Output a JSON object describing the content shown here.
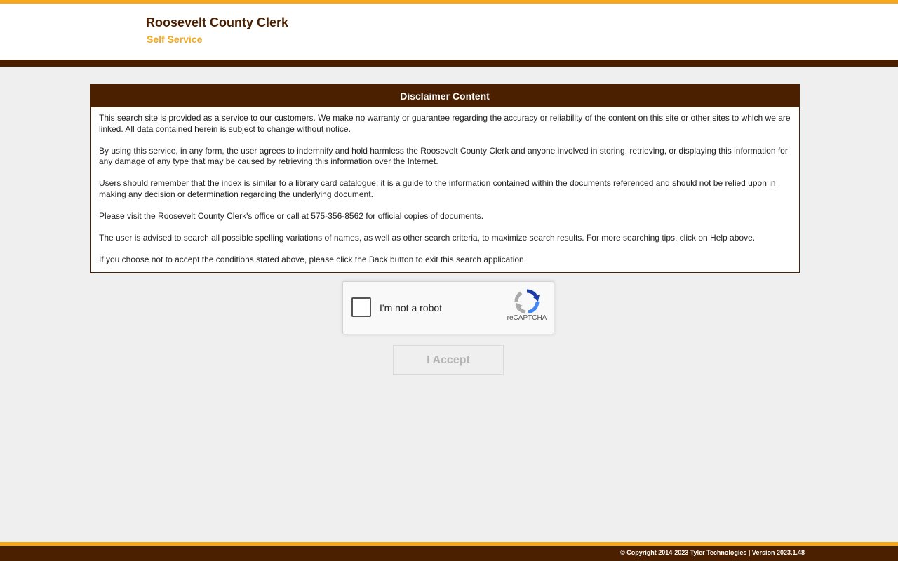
{
  "header": {
    "title": "Roosevelt County Clerk",
    "subtitle": "Self Service"
  },
  "disclaimer": {
    "heading": "Disclaimer Content",
    "paragraphs": [
      "This search site is provided as a service to our customers. We make no warranty or guarantee regarding the accuracy or reliability of the content on this site or other sites to which we are linked. All data contained herein is subject to change without notice.",
      "By using this service, in any form, the user agrees to indemnify and hold harmless the Roosevelt County Clerk and anyone involved in storing, retrieving, or displaying this information for any damage of any type that may be caused by retrieving this information over the Internet.",
      "Users should remember that the index is similar to a library card catalogue; it is a guide to the information contained within the documents referenced and should not be relied upon in making any decision or determination regarding the underlying document.",
      "Please visit the Roosevelt County Clerk's office or call at 575-356-8562 for official copies of documents.",
      "The user is advised to search all possible spelling variations of names, as well as other search criteria, to maximize search results. For more searching tips, click on Help above.",
      "If you choose not to accept the conditions stated above, please click the Back button to exit this search application."
    ]
  },
  "captcha": {
    "label": "I'm not a robot",
    "brand": "reCAPTCHA",
    "checked": false,
    "icon": "recaptcha-icon"
  },
  "accept_button": {
    "label": "I Accept",
    "enabled": false
  },
  "footer": {
    "copyright": "© Copyright 2014-2023 Tyler Technologies | Version 2023.1.48"
  },
  "colors": {
    "brand_brown": "#4b2000",
    "brand_gold": "#f5a81c",
    "page_background": "#efefef"
  }
}
